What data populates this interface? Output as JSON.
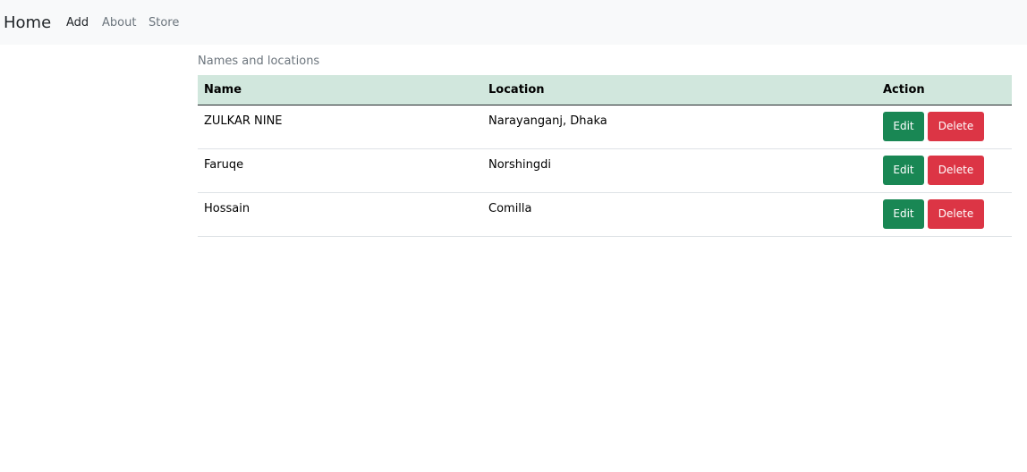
{
  "navbar": {
    "brand": "Home",
    "links": [
      {
        "label": "Add"
      },
      {
        "label": "About"
      },
      {
        "label": "Store"
      }
    ]
  },
  "table": {
    "caption": "Names and locations",
    "headers": [
      "Name",
      "Location",
      "Action"
    ],
    "rows": [
      {
        "name": "ZULKAR NINE",
        "location": "Narayanganj, Dhaka",
        "edit_label": "Edit",
        "delete_label": "Delete"
      },
      {
        "name": "Faruqe",
        "location": "Norshingdi",
        "edit_label": "Edit",
        "delete_label": "Delete"
      },
      {
        "name": "Hossain",
        "location": "Comilla",
        "edit_label": "Edit",
        "delete_label": "Delete"
      }
    ]
  },
  "colors": {
    "navbar_bg": "#f8f9fa",
    "header_bg": "#d1e7dd",
    "edit_button": "#198754",
    "delete_button": "#dc3545"
  }
}
